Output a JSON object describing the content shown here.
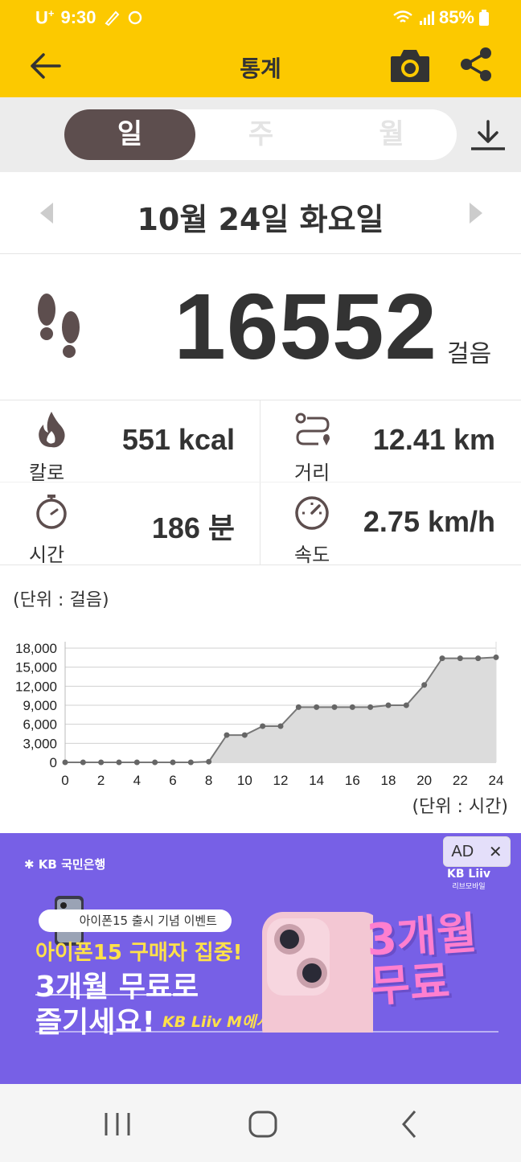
{
  "status": {
    "carrier": "U",
    "carrier_sup": "+",
    "time": "9:30",
    "battery": "85%"
  },
  "header": {
    "title": "통계"
  },
  "period_tabs": [
    {
      "label": "일",
      "active": true
    },
    {
      "label": "주",
      "active": false
    },
    {
      "label": "월",
      "active": false
    }
  ],
  "date": "10월 24일 화요일",
  "steps": {
    "value": "16552",
    "unit": "걸음"
  },
  "metrics": {
    "calories": {
      "label": "칼로",
      "value": "551 kcal",
      "icon": "flame-icon"
    },
    "distance": {
      "label": "거리",
      "value": "12.41 km",
      "icon": "route-icon"
    },
    "time": {
      "label": "시간",
      "value": "186 분",
      "icon": "stopwatch-icon"
    },
    "speed": {
      "label": "속도",
      "value": "2.75 km/h",
      "icon": "speedometer-icon"
    }
  },
  "chart_data": {
    "type": "area",
    "y_unit_label": "(단위 : 걸음)",
    "x_unit_label": "(단위 : 시간)",
    "x": [
      0,
      1,
      2,
      3,
      4,
      5,
      6,
      7,
      8,
      9,
      10,
      11,
      12,
      13,
      14,
      15,
      16,
      17,
      18,
      19,
      20,
      21,
      22,
      23,
      24
    ],
    "values": [
      0,
      0,
      0,
      0,
      0,
      0,
      0,
      0,
      100,
      4300,
      4300,
      5700,
      5700,
      8700,
      8700,
      8700,
      8700,
      8700,
      9000,
      9000,
      12200,
      16400,
      16400,
      16400,
      16552
    ],
    "x_ticks": [
      "0",
      "2",
      "4",
      "6",
      "8",
      "10",
      "12",
      "14",
      "16",
      "18",
      "20",
      "22",
      "24"
    ],
    "y_ticks": [
      "0",
      "3,000",
      "6,000",
      "9,000",
      "12,000",
      "15,000",
      "18,000"
    ],
    "ylim": [
      0,
      18000
    ],
    "xlim": [
      0,
      24
    ],
    "grid": true,
    "colors": {
      "line": "#777777",
      "fill": "#dcdcdc",
      "point": "#666666"
    }
  },
  "ad": {
    "badge": "AD",
    "close": "✕",
    "bank": "KB 국민은행",
    "liiv": "KB Liiv",
    "liiv_sub": "리브모바일",
    "pill": "아이폰15 출시 기념 이벤트",
    "headline": "아이폰15 구매자 집중!",
    "line1": "3개월 무료로",
    "line2": "즐기세요!",
    "sub": "KB Liiv M에서",
    "promo1": "3개월",
    "promo2": "무료"
  },
  "colors": {
    "accent": "#fcc900",
    "segment_active": "#5d4e4e",
    "ad_bg": "#7760e6"
  }
}
